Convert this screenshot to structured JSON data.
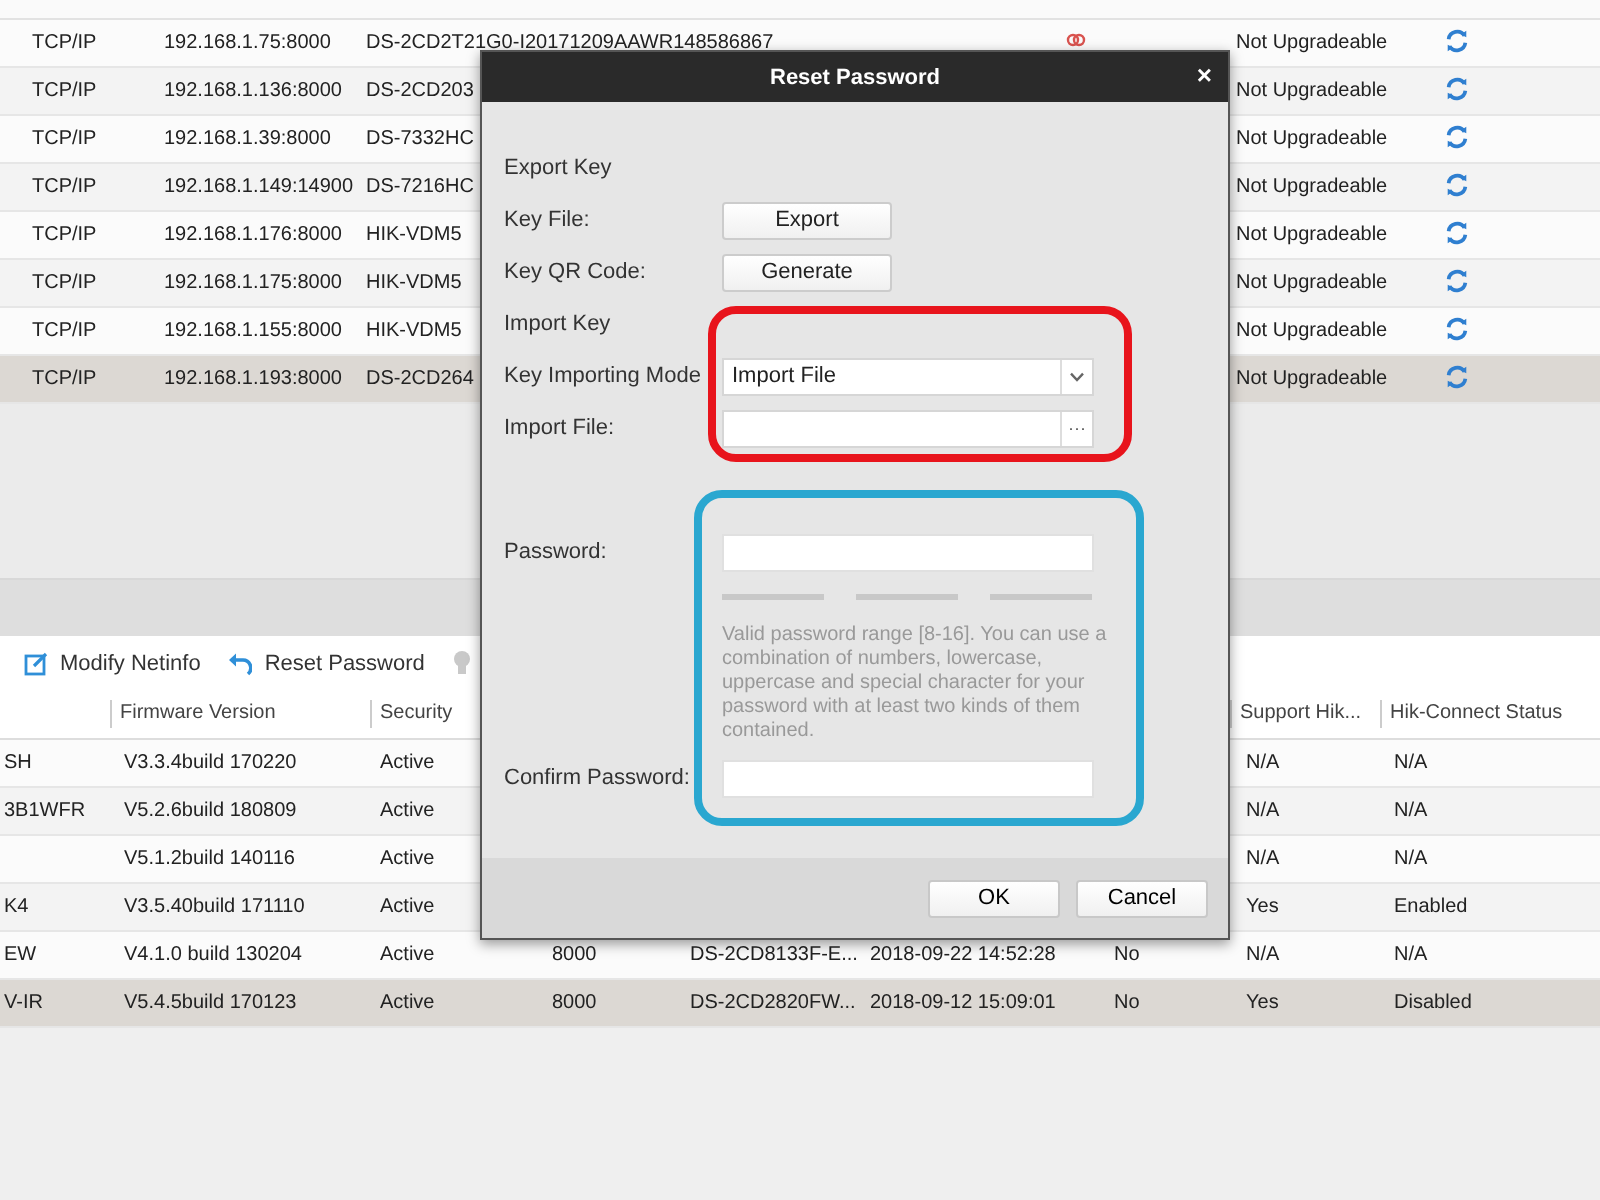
{
  "device_table": {
    "rows": [
      {
        "protocol": "TCP/IP",
        "address": "192.168.1.75:8000",
        "device": "DS-2CD2T21G0-I20171209AAWR148586867",
        "warning": true,
        "upgrade": "Not Upgradeable",
        "selected": false
      },
      {
        "protocol": "TCP/IP",
        "address": "192.168.1.136:8000",
        "device": "DS-2CD203",
        "upgrade": "Not Upgradeable",
        "selected": false
      },
      {
        "protocol": "TCP/IP",
        "address": "192.168.1.39:8000",
        "device": "DS-7332HC",
        "upgrade": "Not Upgradeable",
        "selected": false
      },
      {
        "protocol": "TCP/IP",
        "address": "192.168.1.149:14900",
        "device": "DS-7216HC",
        "upgrade": "Not Upgradeable",
        "selected": false
      },
      {
        "protocol": "TCP/IP",
        "address": "192.168.1.176:8000",
        "device": "HIK-VDM5",
        "upgrade": "Not Upgradeable",
        "selected": false
      },
      {
        "protocol": "TCP/IP",
        "address": "192.168.1.175:8000",
        "device": "HIK-VDM5",
        "upgrade": "Not Upgradeable",
        "selected": false
      },
      {
        "protocol": "TCP/IP",
        "address": "192.168.1.155:8000",
        "device": "HIK-VDM5",
        "upgrade": "Not Upgradeable",
        "selected": false
      },
      {
        "protocol": "TCP/IP",
        "address": "192.168.1.193:8000",
        "device": "DS-2CD264",
        "upgrade": "Not Upgradeable",
        "selected": true
      }
    ]
  },
  "toolbar": [
    {
      "kind": "edit",
      "label": "Modify Netinfo"
    },
    {
      "kind": "undo",
      "label": "Reset Password"
    },
    {
      "kind": "bulb"
    }
  ],
  "detail_table": {
    "columns": {
      "firmware": "Firmware Version",
      "security": "Security",
      "support": "Support Hik...",
      "status": "Hik-Connect Status"
    },
    "rows": [
      {
        "column_1": "SH",
        "firmware": "V3.3.4build 170220",
        "security": "Active",
        "support": "N/A",
        "status": "N/A",
        "selected": false
      },
      {
        "column_1": "3B1WFR",
        "firmware": "V5.2.6build 180809",
        "security": "Active",
        "support": "N/A",
        "status": "N/A",
        "selected": false
      },
      {
        "firmware": "V5.1.2build 140116",
        "security": "Active",
        "support": "N/A",
        "status": "N/A",
        "selected": false
      },
      {
        "column_1": "K4",
        "firmware": "V3.5.40build 171110",
        "security": "Active",
        "support": "Yes",
        "status": "Enabled",
        "selected": false
      },
      {
        "column_1": "EW",
        "firmware": "V4.1.0 build 130204",
        "security": "Active",
        "port": "8000",
        "device": "DS-2CD8133F-E...",
        "time": "2018-09-22 14:52:28",
        "column_7": "No",
        "support": "N/A",
        "status": "N/A",
        "selected": false
      },
      {
        "column_1": "V-IR",
        "firmware": "V5.4.5build 170123",
        "security": "Active",
        "port": "8000",
        "device": "DS-2CD2820FW...",
        "time": "2018-09-12 15:09:01",
        "column_7": "No",
        "support": "Yes",
        "status": "Disabled",
        "selected": true
      }
    ]
  },
  "dialog": {
    "title": "Reset Password",
    "close": "×",
    "export_heading": "Export Key",
    "key_file": {
      "label": "Key File:",
      "button": "Export"
    },
    "key_qr": {
      "label": "Key QR Code:",
      "button": "Generate"
    },
    "import_heading": "Import Key",
    "mode": {
      "label": "Key Importing Mode",
      "value": "Import File"
    },
    "import_file": {
      "label": "Import File:",
      "browse": "···"
    },
    "password": {
      "label": "Password:"
    },
    "strength": [
      {
        "on": false
      },
      {
        "on": false
      },
      {
        "on": false
      }
    ],
    "hint": "Valid password range [8-16]. You can use a combination of numbers, lowercase, uppercase and special character for your password with at least two kinds of them contained.",
    "confirm": {
      "label": "Confirm Password:"
    },
    "buttons": [
      "OK",
      "Cancel"
    ],
    "annotations": [
      {
        "kind": "frame",
        "color": "#e8141c"
      },
      {
        "kind": "frame",
        "color": "#2aa7d0"
      }
    ]
  }
}
